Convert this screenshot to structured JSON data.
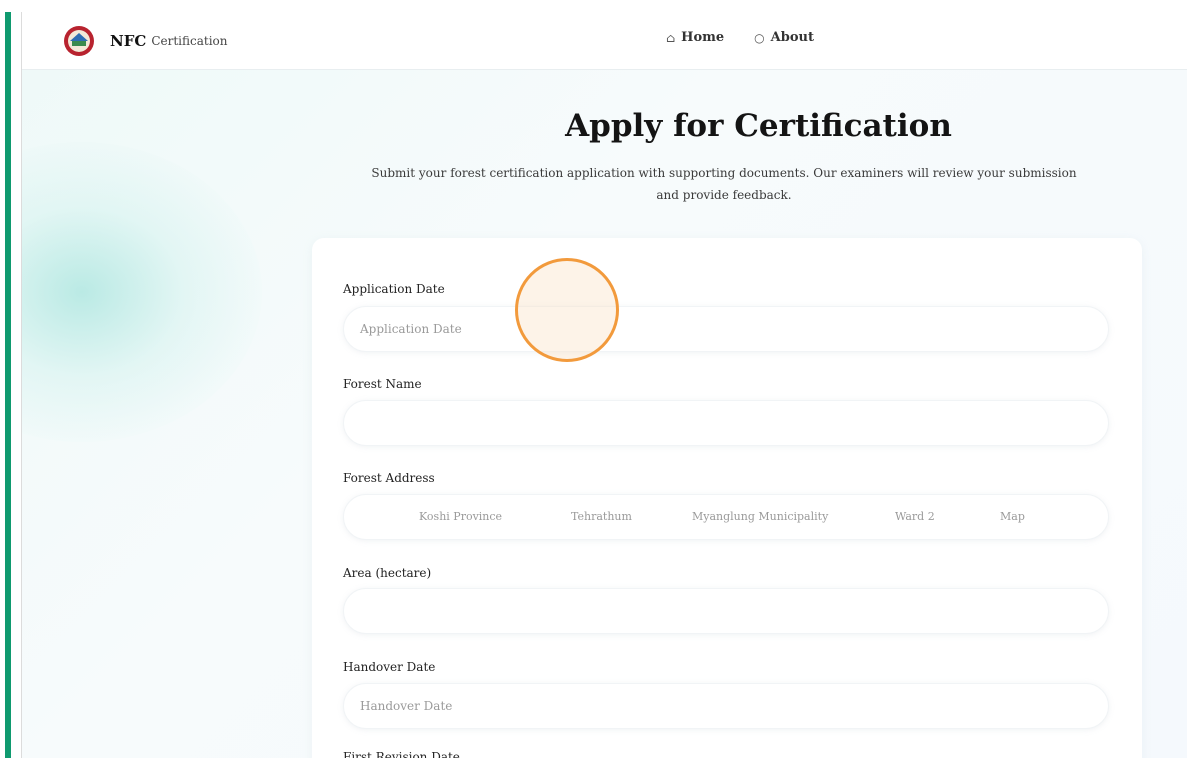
{
  "brand": {
    "name": "NFC",
    "subtitle": "Certification"
  },
  "nav": [
    {
      "label": "Home",
      "icon": "home-icon"
    },
    {
      "label": "About",
      "icon": "info-icon"
    }
  ],
  "page": {
    "title": "Apply for Certification",
    "description": "Submit your forest certification application with supporting documents. Our examiners will review your submission and provide feedback."
  },
  "form": {
    "application_date": {
      "label": "Application Date",
      "placeholder": "Application Date"
    },
    "forest_name": {
      "label": "Forest Name",
      "placeholder": ""
    },
    "forest_address": {
      "label": "Forest Address",
      "parts": [
        "Koshi Province",
        "Tehrathum",
        "Myanglung Municipality",
        "Ward 2",
        "Map"
      ]
    },
    "area": {
      "label": "Area (hectare)",
      "placeholder": ""
    },
    "handover_date": {
      "label": "Handover Date",
      "placeholder": "Handover Date"
    },
    "first_revision_date": {
      "label": "First Revision Date"
    }
  },
  "colors": {
    "accent": "#0f9a6f",
    "cursor_ring": "#f29a3c"
  }
}
